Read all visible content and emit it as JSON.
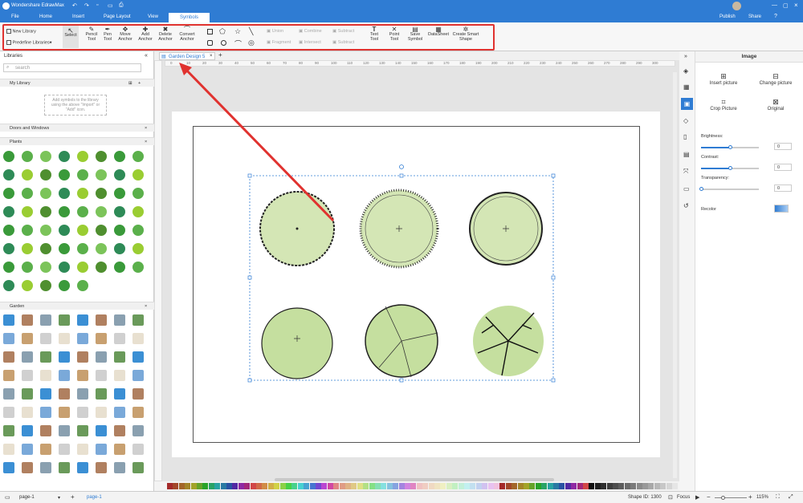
{
  "app": {
    "title": "Wondershare EdrawMax"
  },
  "menu": [
    "File",
    "Home",
    "Insert",
    "Page Layout",
    "View",
    "Symbols"
  ],
  "menu_active": "Symbols",
  "titlebar_right": {
    "publish": "Publish",
    "share": "Share"
  },
  "toolbar": {
    "new_library": "New Library",
    "predefine_libraries": "Predefine Libraries",
    "select": "Select",
    "pencil_tool": [
      "Pencil",
      "Tool"
    ],
    "pen_tool": [
      "Pen",
      "Tool"
    ],
    "move_anchor": [
      "Move",
      "Anchor"
    ],
    "add_anchor": [
      "Add",
      "Anchor"
    ],
    "delete_anchor": [
      "Delete",
      "Anchor"
    ],
    "convert_anchor": [
      "Convert",
      "Anchor"
    ],
    "union": "Union",
    "combine": "Combine",
    "subtract1": "Subtract",
    "fragment": "Fragment",
    "intersect": "Intersect",
    "subtract2": "Subtract",
    "text_tool": [
      "Text",
      "Tool"
    ],
    "point_tool": [
      "Point",
      "Tool"
    ],
    "save_symbol": [
      "Save",
      "Symbol"
    ],
    "datasheet": "DataSheet",
    "create_smart_shape": [
      "Create Smart",
      "Shape"
    ]
  },
  "libraries": {
    "title": "Libraries",
    "search_placeholder": "search",
    "my_library": "My Library",
    "my_library_hint": "Add symbols to the library using the above \"Import\" or \"Add\" icon.",
    "doors_and_windows": "Doors and Windows",
    "plants": "Plants",
    "garden": "Garden"
  },
  "document_tab": {
    "name": "Garden Design 5"
  },
  "ruler_ticks": [
    "0",
    "10",
    "20",
    "30",
    "40",
    "50",
    "60",
    "70",
    "80",
    "90",
    "100",
    "110",
    "120",
    "130",
    "140",
    "150",
    "160",
    "170",
    "180",
    "190",
    "200",
    "210",
    "220",
    "230",
    "240",
    "250",
    "260",
    "270",
    "280",
    "290",
    "300"
  ],
  "right_panel": {
    "title": "Image",
    "insert_picture": "Insert picture",
    "change_picture": "Change picture",
    "crop_picture": "Crop Picture",
    "original": "Original",
    "brightness_label": "Brightness:",
    "brightness_value": "0",
    "contrast_label": "Contrast:",
    "contrast_value": "0",
    "transparency_label": "Transparency:",
    "transparency_value": "0",
    "recolor_label": "Recolor",
    "brightness_level": 0.5,
    "contrast_level": 0.5,
    "transparency_level": 0.0
  },
  "status": {
    "page_select": "page-1",
    "page_tab": "page-1",
    "shape_id": "Shape ID: 1300",
    "focus": "Focus",
    "zoom": "115%"
  },
  "colors": {
    "accent": "#2f7cd3",
    "annotation_red": "#e0322f",
    "plant_fill": "#d4e6b5"
  }
}
